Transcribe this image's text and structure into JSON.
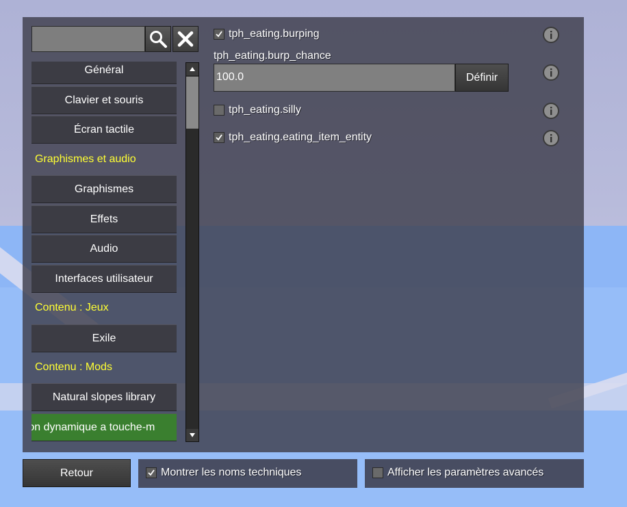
{
  "search": {
    "value": "",
    "placeholder": ""
  },
  "icons": {
    "search": "search-icon",
    "clear": "close-icon",
    "info": "info-icon",
    "check": "check-icon"
  },
  "sidebar": {
    "items": [
      {
        "type": "button",
        "label": "Général"
      },
      {
        "type": "button",
        "label": "Clavier et souris"
      },
      {
        "type": "button",
        "label": "Écran tactile"
      },
      {
        "type": "heading",
        "label": "Graphismes et audio"
      },
      {
        "type": "button",
        "label": "Graphismes"
      },
      {
        "type": "button",
        "label": "Effets"
      },
      {
        "type": "button",
        "label": "Audio"
      },
      {
        "type": "button",
        "label": "Interfaces utilisateur"
      },
      {
        "type": "heading",
        "label": "Contenu : Jeux"
      },
      {
        "type": "button",
        "label": "Exile"
      },
      {
        "type": "heading",
        "label": "Contenu : Mods"
      },
      {
        "type": "button",
        "label": "Natural slopes library"
      },
      {
        "type": "button",
        "label": "Animation dynamique a touche-m",
        "selected": true
      }
    ]
  },
  "settings": {
    "burping": {
      "label": "tph_eating.burping",
      "checked": true
    },
    "burp_chance": {
      "label": "tph_eating.burp_chance",
      "value": "100.0",
      "set_label": "Définir"
    },
    "silly": {
      "label": "tph_eating.silly",
      "checked": false
    },
    "eating_item_entity": {
      "label": "tph_eating.eating_item_entity",
      "checked": true
    }
  },
  "footer": {
    "back_label": "Retour",
    "show_technical_names": {
      "label": "Montrer les noms techniques",
      "checked": true
    },
    "show_advanced": {
      "label": "Afficher les paramètres avancés",
      "checked": false
    }
  },
  "colors": {
    "heading": "#ffff33",
    "selected": "#3a7f2f",
    "panel": "#3e3e4c"
  }
}
